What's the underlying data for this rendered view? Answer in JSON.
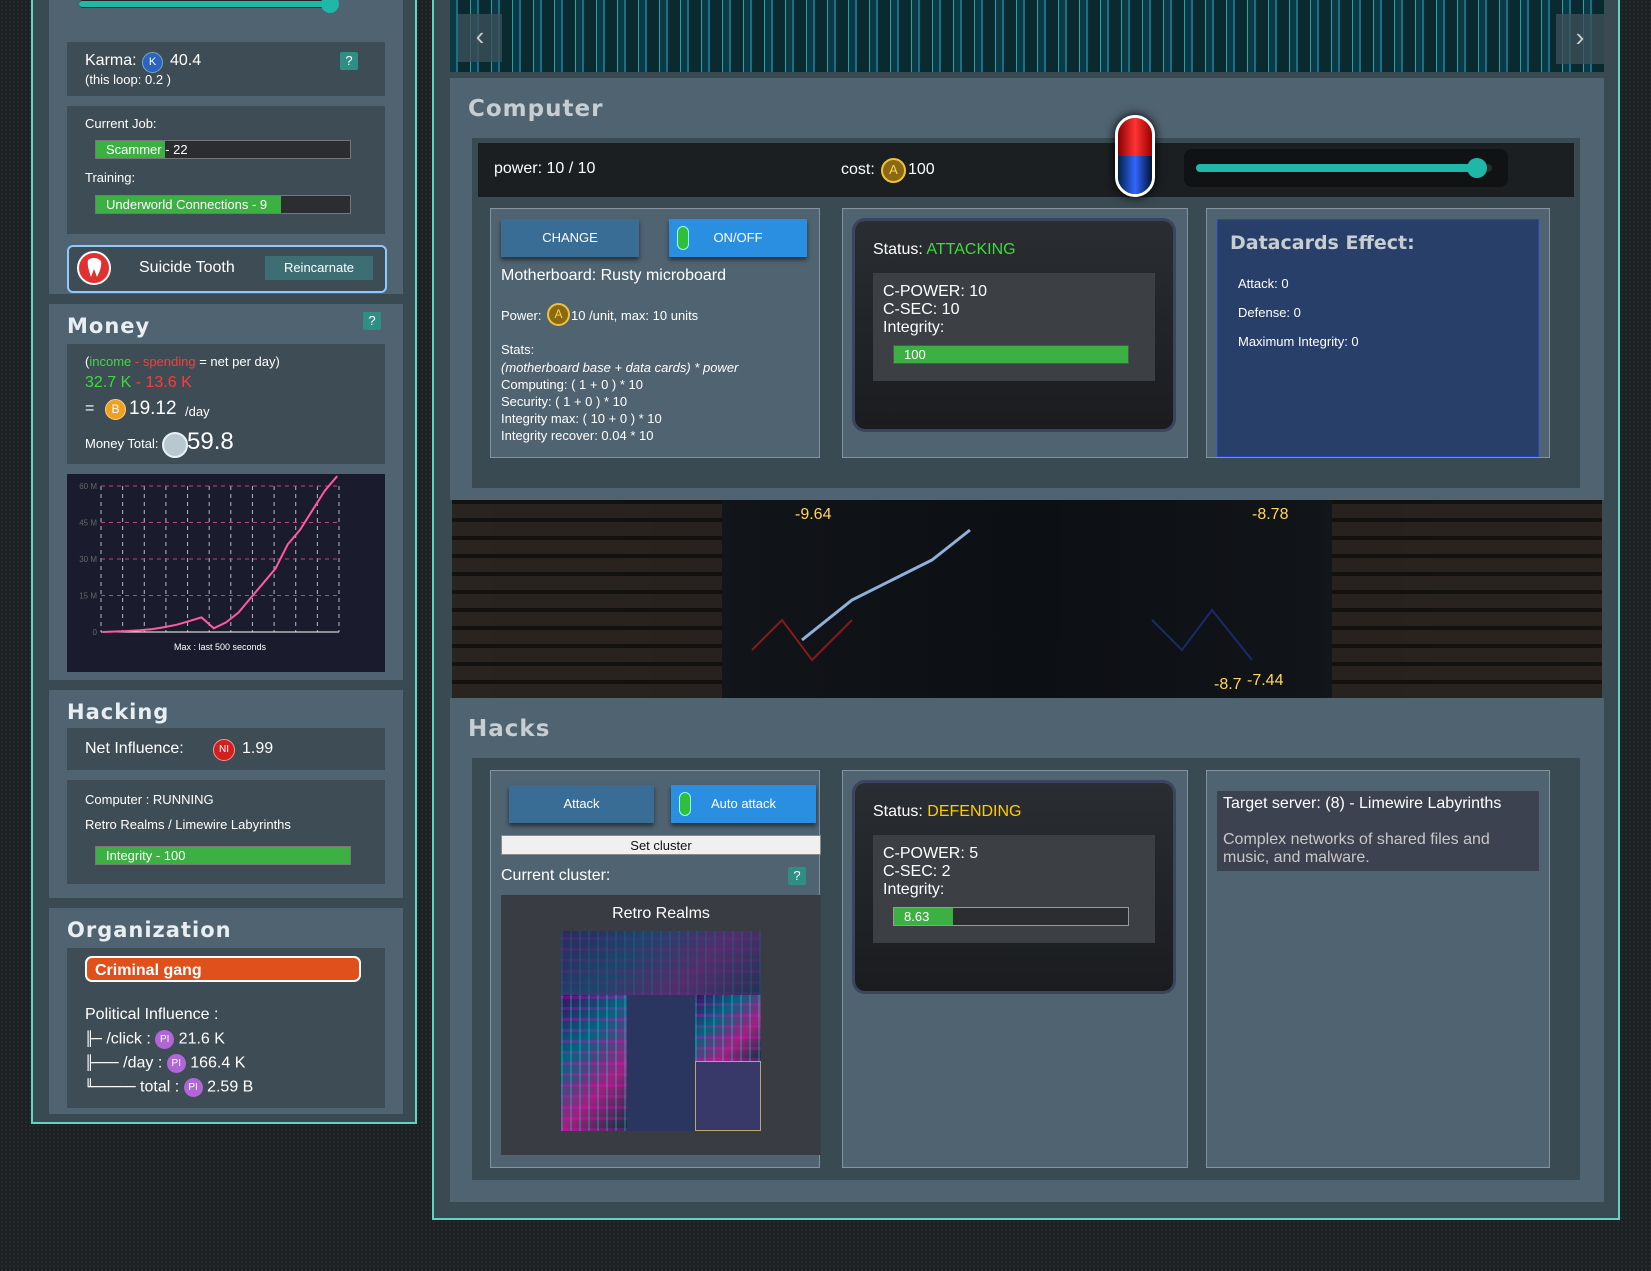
{
  "player": {
    "karma_label": "Karma:",
    "karma_icon": "K",
    "karma_value": "40.4",
    "karma_loop": "(this loop: 0.2 )",
    "job_label": "Current Job:",
    "job_name": "Scammer",
    "job_level": " - 22",
    "job_progress": 0.27,
    "training_label": "Training:",
    "training_name": "Underworld Connections - 9",
    "training_progress": 0.73,
    "tooth_label": "Suicide Tooth",
    "reincarnate_label": "Reincarnate"
  },
  "money": {
    "title": "Money",
    "help": "?",
    "formula_income": "income",
    "formula_minus": " - ",
    "formula_spending": "spending",
    "formula_rest": " = net per day)",
    "income_value": "32.7 K",
    "spending_value": "13.6 K",
    "net_prefix": "=",
    "net_icon": "B",
    "net_value": "19.12",
    "net_unit": "/day",
    "total_label": "Money Total:",
    "total_value": "59.8"
  },
  "chart_data": {
    "type": "line",
    "title": "",
    "xlabel": "Max : last 500 seconds",
    "ylabel": "",
    "yticks": [
      "0",
      "15 M",
      "30 M",
      "45 M",
      "60 M"
    ],
    "ylim": [
      0,
      60
    ],
    "grid": true,
    "series": [
      {
        "values": [
          0,
          0.2,
          0.4,
          0.7,
          1.2,
          2,
          3,
          4.5,
          6,
          1.5,
          4,
          8,
          14,
          20,
          26,
          36,
          42,
          50,
          58,
          64
        ]
      }
    ]
  },
  "hacking": {
    "title": "Hacking",
    "influence_label": "Net Influence:",
    "influence_icon": "NI",
    "influence_value": "1.99",
    "computer_status": "Computer : RUNNING",
    "target": "Retro Realms / Limewire Labyrinths",
    "integrity_label": "Integrity - 100",
    "integrity_progress": 1.0
  },
  "organization": {
    "title": "Organization",
    "gang": "Criminal gang",
    "pi_label": "Political Influence :",
    "click_prefix": "╟─",
    "click_label": "/click :",
    "click_value": "21.6 K",
    "day_prefix": "╟───",
    "day_label": "/day :",
    "day_value": "166.4 K",
    "total_prefix": "╙─────",
    "total_label": "total :",
    "total_value": "2.59 B",
    "pi_icon": "PI"
  },
  "nav": {
    "prev": "‹",
    "next": "›"
  },
  "computer": {
    "title": "Computer",
    "power_text": "power: 10 / 10",
    "cost_label": "cost:",
    "cost_icon": "A",
    "cost_value": "100",
    "power_slider": 0.95,
    "change_label": "CHANGE",
    "onoff_label": "ON/OFF",
    "motherboard": "Motherboard: Rusty microboard",
    "power_label": "Power:",
    "power_icon": "A",
    "power_spec": "10 /unit, max: 10 units",
    "stats_label": "Stats:",
    "stats_formula": "(motherboard base + data cards) * power",
    "stat_computing": "Computing: ( 1  + 0  ) * 10",
    "stat_security": "Security: ( 1  + 0  ) * 10",
    "stat_integrity": "Integrity max: ( 10  + 0  ) * 10",
    "stat_recover": "Integrity recover: 0.04  * 10",
    "status_label": "Status:",
    "status_value": "ATTACKING",
    "cpower": "C-POWER: 10",
    "csec": "C-SEC: 10",
    "integrity_label": "Integrity:",
    "integrity_value": "100",
    "integrity_progress": 1.0,
    "datacards_title": "Datacards Effect:",
    "dc_attack": "Attack: 0",
    "dc_defense": "Defense: 0",
    "dc_integrity": "Maximum Integrity: 0"
  },
  "banner": {
    "float_1": "-9.64",
    "float_2": "-8.78",
    "float_3": "-8.7",
    "float_4": "-7.44"
  },
  "hacks": {
    "title": "Hacks",
    "attack_label": "Attack",
    "auto_label": "Auto attack",
    "set_cluster_label": "Set cluster",
    "cluster_label": "Current cluster:",
    "help": "?",
    "cluster_name": "Retro Realms",
    "status_label": "Status:",
    "status_value": "DEFENDING",
    "cpower": "C-POWER: 5",
    "csec": "C-SEC: 2",
    "integrity_label": "Integrity:",
    "integrity_value": "8.63",
    "integrity_progress": 0.25,
    "target_title": "Target server: (8) - Limewire Labyrinths",
    "target_desc": "Complex networks of shared files and music, and malware."
  },
  "colors": {
    "accent": "#5fd6bf",
    "green_status": "#3cdc3c",
    "yellow_status": "#ffcc00",
    "income": "#3cdc3c",
    "spending": "#ff3a3a",
    "gang": "#e0501c",
    "pi": "#b066d6"
  }
}
